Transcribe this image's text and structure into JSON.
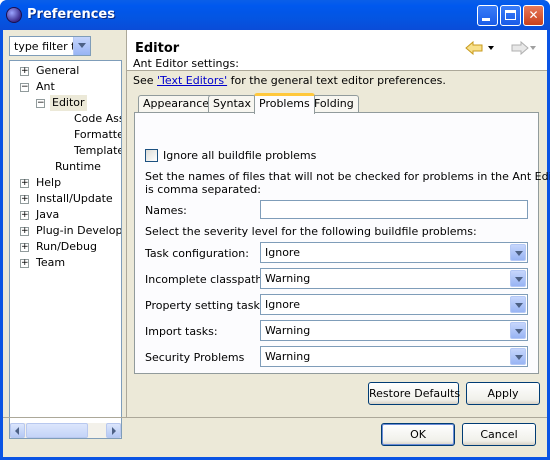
{
  "window": {
    "title": "Preferences"
  },
  "filter": {
    "value": "type filter t"
  },
  "tree": {
    "items": [
      {
        "label": "General",
        "expander": "+"
      },
      {
        "label": "Ant",
        "expander": "−"
      },
      {
        "label": "Editor",
        "expander": "−"
      },
      {
        "label": "Code Assist",
        "expander": ""
      },
      {
        "label": "Formatter",
        "expander": ""
      },
      {
        "label": "Templates",
        "expander": ""
      },
      {
        "label": "Runtime",
        "expander": ""
      },
      {
        "label": "Help",
        "expander": "+"
      },
      {
        "label": "Install/Update",
        "expander": "+"
      },
      {
        "label": "Java",
        "expander": "+"
      },
      {
        "label": "Plug-in Development",
        "expander": "+"
      },
      {
        "label": "Run/Debug",
        "expander": "+"
      },
      {
        "label": "Team",
        "expander": "+"
      }
    ]
  },
  "page": {
    "title": "Editor",
    "settings_label": "Ant Editor settings:",
    "see_prefix": "See ",
    "see_link": "'Text Editors'",
    "see_suffix": " for the general text editor preferences."
  },
  "tabs": [
    "Appearance",
    "Syntax",
    "Problems",
    "Folding"
  ],
  "problems": {
    "ignore_all_label": "Ignore all buildfile problems",
    "names_desc_1": "Set the names of files that will not be checked for problems in the Ant Editor. List",
    "names_desc_2": "is comma separated:",
    "names_label": "Names:",
    "names_value": "",
    "severity_desc": "Select the severity level for the following buildfile problems:",
    "rows": [
      {
        "label": "Task configuration:",
        "value": "Ignore"
      },
      {
        "label": "Incomplete classpath:",
        "value": "Warning"
      },
      {
        "label": "Property setting tasks:",
        "value": "Ignore"
      },
      {
        "label": "Import tasks:",
        "value": "Warning"
      },
      {
        "label": "Security Problems",
        "value": "Warning"
      }
    ]
  },
  "buttons": {
    "restore_defaults": "Restore Defaults",
    "apply": "Apply",
    "ok": "OK",
    "cancel": "Cancel"
  }
}
